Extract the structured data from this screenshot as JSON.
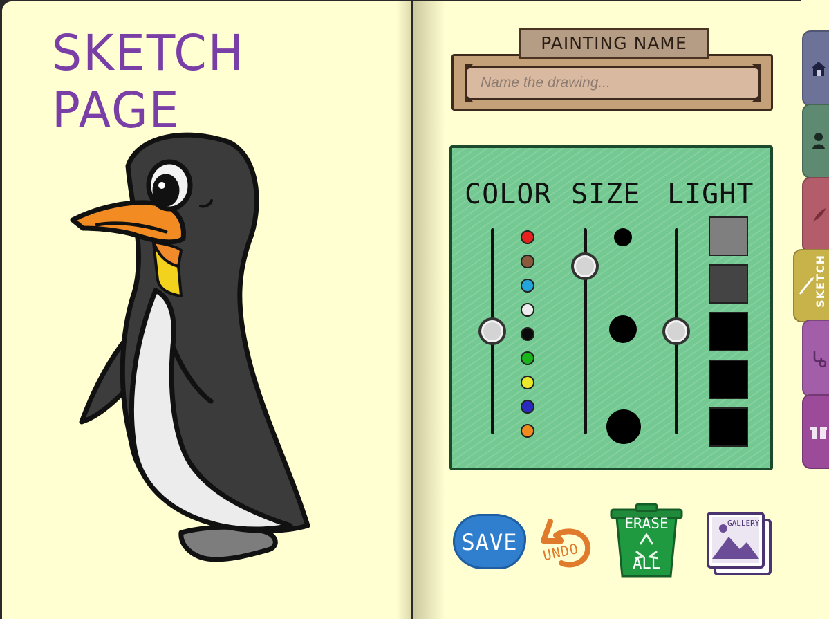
{
  "left_page": {
    "title": "SKETCH PAGE"
  },
  "name_board": {
    "plaque_label": "PAINTING NAME",
    "input_placeholder": "Name the drawing...",
    "input_value": ""
  },
  "palette": {
    "column_labels": {
      "color": "COLOR",
      "size": "SIZE",
      "light": "LIGHT"
    },
    "colors": [
      "#e8211f",
      "#8b5a3c",
      "#22a4dc",
      "#ececec",
      "#0a0a0a",
      "#1bb51b",
      "#eaea2a",
      "#2a2ac0",
      "#f08a1e"
    ],
    "brush_sizes": [
      "small",
      "medium",
      "large"
    ],
    "light_levels": [
      "#7f7f7f",
      "#444444",
      "#000000",
      "#000000",
      "#000000"
    ],
    "selected": {
      "color": "#0a0a0a",
      "size": "small-medium",
      "light": "#000000"
    }
  },
  "actions": {
    "save": "SAVE",
    "undo": "UNDO",
    "erase": [
      "ERASE",
      "ALL"
    ],
    "gallery": "GALLERY"
  },
  "tabs": [
    {
      "name": "home",
      "icon": "house-icon",
      "color": "#6d7398"
    },
    {
      "name": "character",
      "icon": "person-icon",
      "color": "#5f8a72"
    },
    {
      "name": "write",
      "icon": "feather-icon",
      "color": "#b35c6a"
    },
    {
      "name": "sketch",
      "icon": "brush-icon",
      "label": "SKETCH",
      "color": "#c8b24a",
      "active": true
    },
    {
      "name": "doctor",
      "icon": "stethoscope-icon",
      "color": "#a35eaa"
    },
    {
      "name": "gift",
      "icon": "gift-icon",
      "color": "#9b4b9a"
    }
  ]
}
